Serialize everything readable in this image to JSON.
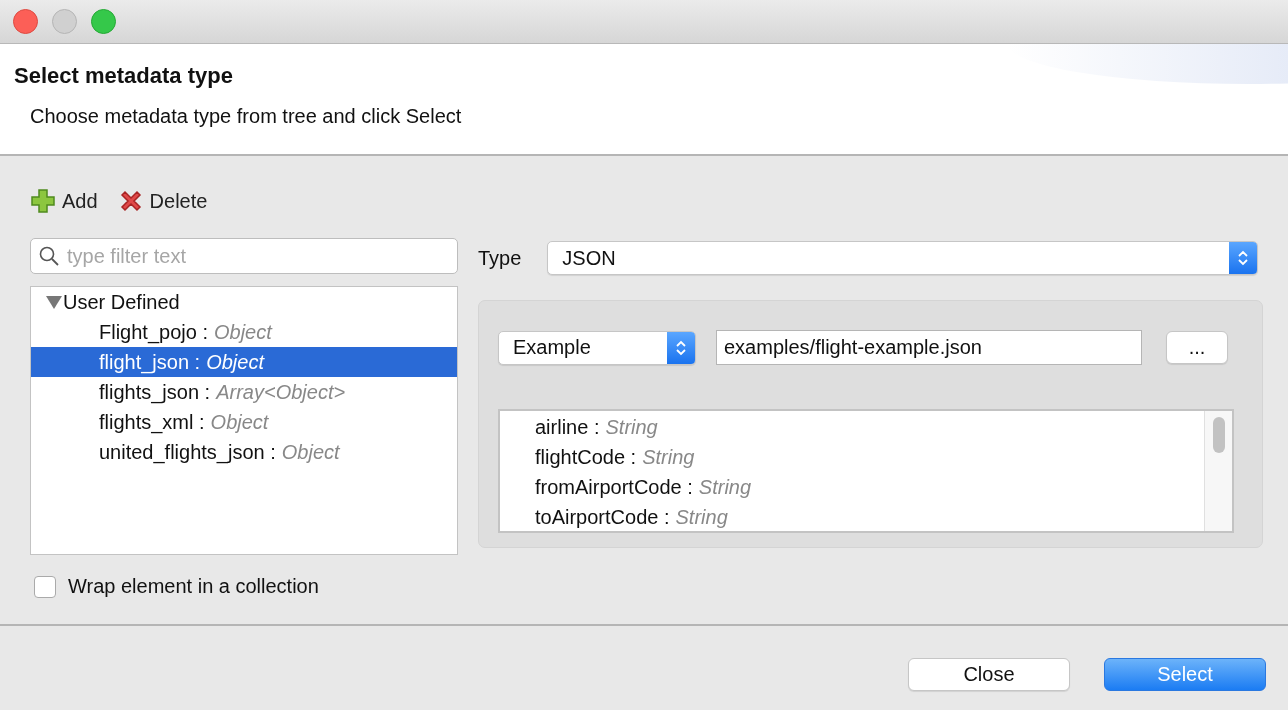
{
  "header": {
    "title": "Select metadata type",
    "subtitle": "Choose metadata type from tree and click Select"
  },
  "toolbar": [
    {
      "label": "Add",
      "kind": "add"
    },
    {
      "label": "Delete",
      "kind": "delete"
    }
  ],
  "filter": {
    "placeholder": "type filter text"
  },
  "tree": [
    {
      "label": "User Defined",
      "expanded": true,
      "selected": false,
      "children": [
        {
          "name": "Flight_pojo :",
          "type": "Object",
          "selected": false
        },
        {
          "name": "flight_json :",
          "type": "Object",
          "selected": true
        },
        {
          "name": "flights_json :",
          "type": "Array<Object>",
          "selected": false
        },
        {
          "name": "flights_xml :",
          "type": "Object",
          "selected": false
        },
        {
          "name": "united_flights_json :",
          "type": "Object",
          "selected": false
        }
      ]
    }
  ],
  "wrap_option": {
    "label": "Wrap element in a collection",
    "checked": false
  },
  "type_field": {
    "label": "Type",
    "value": "JSON"
  },
  "source": {
    "mode": "Example",
    "path": "examples/flight-example.json",
    "browse": "..."
  },
  "fields": [
    {
      "name": "airline :",
      "type": "String"
    },
    {
      "name": "flightCode :",
      "type": "String"
    },
    {
      "name": "fromAirportCode :",
      "type": "String"
    },
    {
      "name": "toAirportCode :",
      "type": "String"
    }
  ],
  "buttons": [
    {
      "label": "Close",
      "kind": "default"
    },
    {
      "label": "Select",
      "kind": "primary"
    }
  ]
}
